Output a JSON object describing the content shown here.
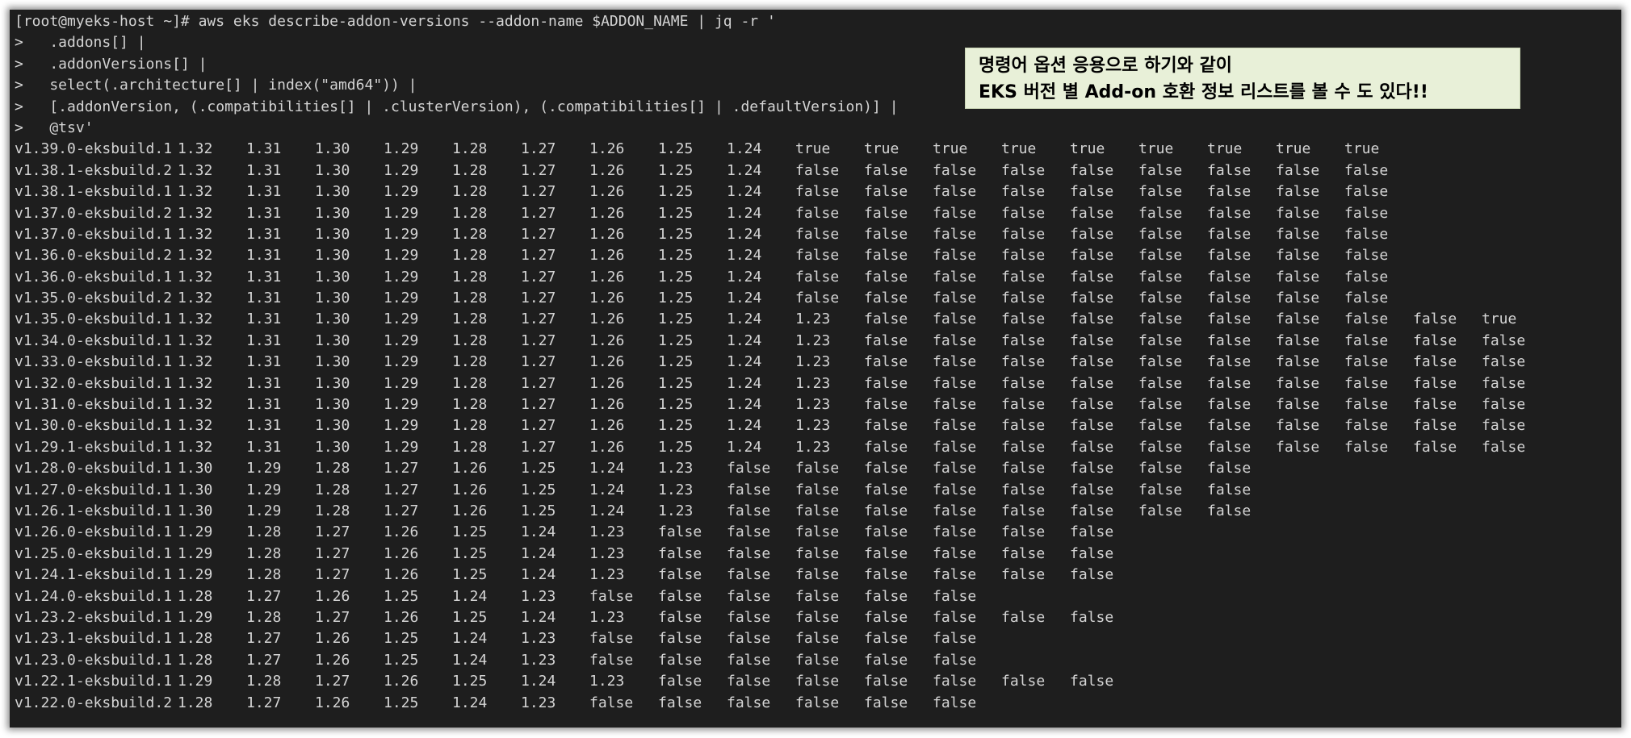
{
  "terminal": {
    "command_lines": [
      "[root@myeks-host ~]# aws eks describe-addon-versions --addon-name $ADDON_NAME | jq -r '",
      ">   .addons[] |",
      ">   .addonVersions[] |",
      ">   select(.architecture[] | index(\"amd64\")) |",
      ">   [.addonVersion, (.compatibilities[] | .clusterVersion), (.compatibilities[] | .defaultVersion)] |",
      ">   @tsv'"
    ],
    "output_rows": [
      [
        "v1.39.0-eksbuild.1",
        "1.32",
        "1.31",
        "1.30",
        "1.29",
        "1.28",
        "1.27",
        "1.26",
        "1.25",
        "1.24",
        "true",
        "true",
        "true",
        "true",
        "true",
        "true",
        "true",
        "true",
        "true"
      ],
      [
        "v1.38.1-eksbuild.2",
        "1.32",
        "1.31",
        "1.30",
        "1.29",
        "1.28",
        "1.27",
        "1.26",
        "1.25",
        "1.24",
        "false",
        "false",
        "false",
        "false",
        "false",
        "false",
        "false",
        "false",
        "false"
      ],
      [
        "v1.38.1-eksbuild.1",
        "1.32",
        "1.31",
        "1.30",
        "1.29",
        "1.28",
        "1.27",
        "1.26",
        "1.25",
        "1.24",
        "false",
        "false",
        "false",
        "false",
        "false",
        "false",
        "false",
        "false",
        "false"
      ],
      [
        "v1.37.0-eksbuild.2",
        "1.32",
        "1.31",
        "1.30",
        "1.29",
        "1.28",
        "1.27",
        "1.26",
        "1.25",
        "1.24",
        "false",
        "false",
        "false",
        "false",
        "false",
        "false",
        "false",
        "false",
        "false"
      ],
      [
        "v1.37.0-eksbuild.1",
        "1.32",
        "1.31",
        "1.30",
        "1.29",
        "1.28",
        "1.27",
        "1.26",
        "1.25",
        "1.24",
        "false",
        "false",
        "false",
        "false",
        "false",
        "false",
        "false",
        "false",
        "false"
      ],
      [
        "v1.36.0-eksbuild.2",
        "1.32",
        "1.31",
        "1.30",
        "1.29",
        "1.28",
        "1.27",
        "1.26",
        "1.25",
        "1.24",
        "false",
        "false",
        "false",
        "false",
        "false",
        "false",
        "false",
        "false",
        "false"
      ],
      [
        "v1.36.0-eksbuild.1",
        "1.32",
        "1.31",
        "1.30",
        "1.29",
        "1.28",
        "1.27",
        "1.26",
        "1.25",
        "1.24",
        "false",
        "false",
        "false",
        "false",
        "false",
        "false",
        "false",
        "false",
        "false"
      ],
      [
        "v1.35.0-eksbuild.2",
        "1.32",
        "1.31",
        "1.30",
        "1.29",
        "1.28",
        "1.27",
        "1.26",
        "1.25",
        "1.24",
        "false",
        "false",
        "false",
        "false",
        "false",
        "false",
        "false",
        "false",
        "false"
      ],
      [
        "v1.35.0-eksbuild.1",
        "1.32",
        "1.31",
        "1.30",
        "1.29",
        "1.28",
        "1.27",
        "1.26",
        "1.25",
        "1.24",
        "1.23",
        "false",
        "false",
        "false",
        "false",
        "false",
        "false",
        "false",
        "false",
        "false",
        "true"
      ],
      [
        "v1.34.0-eksbuild.1",
        "1.32",
        "1.31",
        "1.30",
        "1.29",
        "1.28",
        "1.27",
        "1.26",
        "1.25",
        "1.24",
        "1.23",
        "false",
        "false",
        "false",
        "false",
        "false",
        "false",
        "false",
        "false",
        "false",
        "false"
      ],
      [
        "v1.33.0-eksbuild.1",
        "1.32",
        "1.31",
        "1.30",
        "1.29",
        "1.28",
        "1.27",
        "1.26",
        "1.25",
        "1.24",
        "1.23",
        "false",
        "false",
        "false",
        "false",
        "false",
        "false",
        "false",
        "false",
        "false",
        "false"
      ],
      [
        "v1.32.0-eksbuild.1",
        "1.32",
        "1.31",
        "1.30",
        "1.29",
        "1.28",
        "1.27",
        "1.26",
        "1.25",
        "1.24",
        "1.23",
        "false",
        "false",
        "false",
        "false",
        "false",
        "false",
        "false",
        "false",
        "false",
        "false"
      ],
      [
        "v1.31.0-eksbuild.1",
        "1.32",
        "1.31",
        "1.30",
        "1.29",
        "1.28",
        "1.27",
        "1.26",
        "1.25",
        "1.24",
        "1.23",
        "false",
        "false",
        "false",
        "false",
        "false",
        "false",
        "false",
        "false",
        "false",
        "false"
      ],
      [
        "v1.30.0-eksbuild.1",
        "1.32",
        "1.31",
        "1.30",
        "1.29",
        "1.28",
        "1.27",
        "1.26",
        "1.25",
        "1.24",
        "1.23",
        "false",
        "false",
        "false",
        "false",
        "false",
        "false",
        "false",
        "false",
        "false",
        "false"
      ],
      [
        "v1.29.1-eksbuild.1",
        "1.32",
        "1.31",
        "1.30",
        "1.29",
        "1.28",
        "1.27",
        "1.26",
        "1.25",
        "1.24",
        "1.23",
        "false",
        "false",
        "false",
        "false",
        "false",
        "false",
        "false",
        "false",
        "false",
        "false"
      ],
      [
        "v1.28.0-eksbuild.1",
        "1.30",
        "1.29",
        "1.28",
        "1.27",
        "1.26",
        "1.25",
        "1.24",
        "1.23",
        "false",
        "false",
        "false",
        "false",
        "false",
        "false",
        "false",
        "false"
      ],
      [
        "v1.27.0-eksbuild.1",
        "1.30",
        "1.29",
        "1.28",
        "1.27",
        "1.26",
        "1.25",
        "1.24",
        "1.23",
        "false",
        "false",
        "false",
        "false",
        "false",
        "false",
        "false",
        "false"
      ],
      [
        "v1.26.1-eksbuild.1",
        "1.30",
        "1.29",
        "1.28",
        "1.27",
        "1.26",
        "1.25",
        "1.24",
        "1.23",
        "false",
        "false",
        "false",
        "false",
        "false",
        "false",
        "false",
        "false"
      ],
      [
        "v1.26.0-eksbuild.1",
        "1.29",
        "1.28",
        "1.27",
        "1.26",
        "1.25",
        "1.24",
        "1.23",
        "false",
        "false",
        "false",
        "false",
        "false",
        "false",
        "false"
      ],
      [
        "v1.25.0-eksbuild.1",
        "1.29",
        "1.28",
        "1.27",
        "1.26",
        "1.25",
        "1.24",
        "1.23",
        "false",
        "false",
        "false",
        "false",
        "false",
        "false",
        "false"
      ],
      [
        "v1.24.1-eksbuild.1",
        "1.29",
        "1.28",
        "1.27",
        "1.26",
        "1.25",
        "1.24",
        "1.23",
        "false",
        "false",
        "false",
        "false",
        "false",
        "false",
        "false"
      ],
      [
        "v1.24.0-eksbuild.1",
        "1.28",
        "1.27",
        "1.26",
        "1.25",
        "1.24",
        "1.23",
        "false",
        "false",
        "false",
        "false",
        "false",
        "false"
      ],
      [
        "v1.23.2-eksbuild.1",
        "1.29",
        "1.28",
        "1.27",
        "1.26",
        "1.25",
        "1.24",
        "1.23",
        "false",
        "false",
        "false",
        "false",
        "false",
        "false",
        "false"
      ],
      [
        "v1.23.1-eksbuild.1",
        "1.28",
        "1.27",
        "1.26",
        "1.25",
        "1.24",
        "1.23",
        "false",
        "false",
        "false",
        "false",
        "false",
        "false"
      ],
      [
        "v1.23.0-eksbuild.1",
        "1.28",
        "1.27",
        "1.26",
        "1.25",
        "1.24",
        "1.23",
        "false",
        "false",
        "false",
        "false",
        "false",
        "false"
      ],
      [
        "v1.22.1-eksbuild.1",
        "1.29",
        "1.28",
        "1.27",
        "1.26",
        "1.25",
        "1.24",
        "1.23",
        "false",
        "false",
        "false",
        "false",
        "false",
        "false",
        "false"
      ],
      [
        "v1.22.0-eksbuild.2",
        "1.28",
        "1.27",
        "1.26",
        "1.25",
        "1.24",
        "1.23",
        "false",
        "false",
        "false",
        "false",
        "false",
        "false"
      ]
    ]
  },
  "annotation": {
    "line1": "명령어 옵션 응용으로 하기와 같이",
    "line2": "EKS 버전 별 Add-on 호환 정보 리스트를 볼 수 도 있다!!"
  },
  "colors": {
    "terminal_bg": "#1e1e1e",
    "terminal_text": "#d4d4d4",
    "annotation_bg": "#e8f0d8"
  }
}
